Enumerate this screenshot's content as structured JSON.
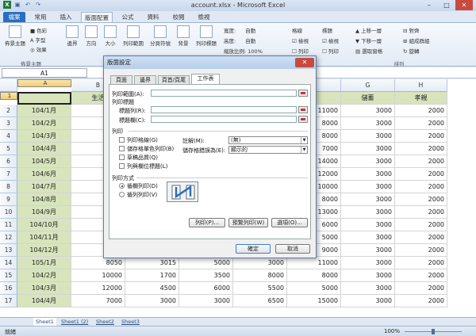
{
  "window": {
    "title": "account.xlsx - Microsoft Excel"
  },
  "tabs": [
    "檔案",
    "常用",
    "插入",
    "版面配置",
    "公式",
    "資料",
    "校閱",
    "檢視"
  ],
  "ribbon": {
    "theme_btn": "佈景主題",
    "colors": "色彩",
    "fonts": "字型",
    "effects": "效果",
    "margins": "邊界",
    "orientation": "方向",
    "size": "大小",
    "print_area": "列印範圍",
    "breaks": "分頁符號",
    "background": "背景",
    "print_titles": "列印標題",
    "width_label": "寬度:",
    "width_val": "自動",
    "height_label": "高度:",
    "height_val": "自動",
    "scale_label": "縮放比例:",
    "scale_val": "100%",
    "gridlines": "格線",
    "headings": "標題",
    "view": "檢視",
    "print": "列印",
    "bring_forward": "上移一層",
    "send_backward": "下移一層",
    "selection_pane": "選取窗格",
    "align": "對齊",
    "group": "組成群組",
    "rotate": "旋轉",
    "group_themes": "佈景主題",
    "group_arrange": "排列"
  },
  "formula_bar": {
    "name_box": "A1"
  },
  "grid": {
    "columns": [
      "A",
      "B",
      "C",
      "D",
      "E",
      "F",
      "G",
      "H"
    ],
    "header_row": [
      "",
      "生活",
      "",
      "",
      "",
      "",
      "儲蓄",
      "孝親"
    ],
    "rows": [
      {
        "n": "2",
        "a": "104/1月",
        "b": "",
        "c": "",
        "d": "",
        "e": "",
        "f": "11000",
        "g": "3000",
        "h": "2000"
      },
      {
        "n": "3",
        "a": "104/2月",
        "b": "",
        "c": "",
        "d": "",
        "e": "",
        "f": "8000",
        "g": "3000",
        "h": "2000"
      },
      {
        "n": "4",
        "a": "104/3月",
        "b": "",
        "c": "",
        "d": "",
        "e": "",
        "f": "8000",
        "g": "3000",
        "h": "2000"
      },
      {
        "n": "5",
        "a": "104/4月",
        "b": "",
        "c": "",
        "d": "",
        "e": "",
        "f": "7000",
        "g": "3000",
        "h": "2000"
      },
      {
        "n": "6",
        "a": "104/5月",
        "b": "",
        "c": "",
        "d": "",
        "e": "",
        "f": "14000",
        "g": "3000",
        "h": "2000"
      },
      {
        "n": "7",
        "a": "104/6月",
        "b": "",
        "c": "",
        "d": "",
        "e": "",
        "f": "12000",
        "g": "3000",
        "h": "2000"
      },
      {
        "n": "8",
        "a": "104/7月",
        "b": "",
        "c": "",
        "d": "",
        "e": "",
        "f": "10000",
        "g": "3000",
        "h": "2000"
      },
      {
        "n": "9",
        "a": "104/8月",
        "b": "",
        "c": "",
        "d": "",
        "e": "",
        "f": "8000",
        "g": "3000",
        "h": "2000"
      },
      {
        "n": "10",
        "a": "104/9月",
        "b": "",
        "c": "",
        "d": "",
        "e": "",
        "f": "13000",
        "g": "3000",
        "h": "2000"
      },
      {
        "n": "11",
        "a": "104/10月",
        "b": "",
        "c": "",
        "d": "",
        "e": "",
        "f": "6000",
        "g": "3000",
        "h": "2000"
      },
      {
        "n": "12",
        "a": "104/11月",
        "b": "",
        "c": "",
        "d": "",
        "e": "",
        "f": "5000",
        "g": "3000",
        "h": "2000"
      },
      {
        "n": "13",
        "a": "104/12月",
        "b": "",
        "c": "",
        "d": "",
        "e": "",
        "f": "9000",
        "g": "3000",
        "h": "2000"
      },
      {
        "n": "14",
        "a": "105/1月",
        "b": "8050",
        "c": "3015",
        "d": "5000",
        "e": "3000",
        "f": "11000",
        "g": "3000",
        "h": "2000"
      },
      {
        "n": "15",
        "a": "104/2月",
        "b": "10000",
        "c": "1700",
        "d": "3500",
        "e": "8000",
        "f": "8000",
        "g": "3000",
        "h": "2000"
      },
      {
        "n": "16",
        "a": "104/3月",
        "b": "12000",
        "c": "4500",
        "d": "6000",
        "e": "5500",
        "f": "5000",
        "g": "3000",
        "h": "2000"
      },
      {
        "n": "17",
        "a": "104/4月",
        "b": "7000",
        "c": "3000",
        "d": "3000",
        "e": "6500",
        "f": "15000",
        "g": "3000",
        "h": "2000"
      }
    ]
  },
  "sheets": [
    "Sheet1",
    "Sheet1 (2)",
    "Sheet2",
    "Sheet3"
  ],
  "status": {
    "ready": "就緒",
    "zoom": "100%"
  },
  "dialog": {
    "title": "版面設定",
    "tabs": [
      "頁面",
      "邊界",
      "頁首/頁尾",
      "工作表"
    ],
    "print_area": "列印範圍(A):",
    "print_titles": "列印標題",
    "rows_repeat": "標題列(R):",
    "cols_repeat": "標題欄(C):",
    "print_section": "列印",
    "gridlines": "列印格線(G)",
    "bw": "儲存格單色列印(B)",
    "draft": "草稿品質(Q)",
    "headings": "列與欄位標題(L)",
    "comments_label": "註解(M):",
    "comments_val": "(無)",
    "errors_label": "儲存格錯誤為(E):",
    "errors_val": "顯示的",
    "order_section": "列印方式",
    "down_then_over": "循欄列印(D)",
    "over_then_down": "循列列印(V)",
    "print_btn": "列印(P)...",
    "preview_btn": "預覽列印(W)",
    "options_btn": "選項(O)...",
    "ok": "確定",
    "cancel": "取消"
  }
}
